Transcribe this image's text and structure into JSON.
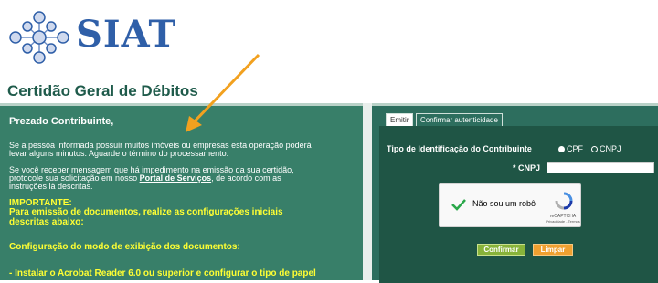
{
  "header": {
    "logo_text": "SIAT",
    "page_title": "Certidão Geral de Débitos"
  },
  "left": {
    "greeting": "Prezado Contribuinte,",
    "para1_line1": "Se a pessoa informada possuir muitos imóveis ou empresas esta operação poderá",
    "para1_line2": "levar alguns minutos. Aguarde o término do processamento.",
    "para2_line1": "Se você receber mensagem que há impedimento na emissão da sua certidão,",
    "para2_line2_a": "protocole sua solicitação em nosso ",
    "para2_link": "Portal de Serviços",
    "para2_line2_b": ", de acordo com as",
    "para2_line3": "instruções lá descritas.",
    "important_title": "IMPORTANTE:",
    "important_line1": "Para emissão de documentos, realize as configurações iniciais",
    "important_line2": "descritas abaixo:",
    "config_title": "Configuração do modo de exibição dos documentos:",
    "config_item": "- Instalar o Acrobat Reader 6.0 ou superior e configurar o tipo de papel"
  },
  "right": {
    "tabs": [
      "Emitir",
      "Confirmar autenticidade"
    ],
    "id_type_label": "Tipo de Identificação do Contribuinte",
    "options": [
      "CPF",
      "CNPJ"
    ],
    "cnpj_label": "* CNPJ",
    "cnpj_value": "",
    "captcha_text": "Não sou um robô",
    "captcha_brand": "reCAPTCHA",
    "captcha_links": "Privacidade - Termos",
    "confirm_button": "Confirmar",
    "clear_button": "Limpar"
  },
  "colors": {
    "left_panel": "#387f69",
    "right_panel": "#2d6e5e",
    "form_area": "#1f5545",
    "highlight_text": "#ffff33",
    "arrow": "#f2a11f",
    "logo": "#2f5fa8"
  }
}
